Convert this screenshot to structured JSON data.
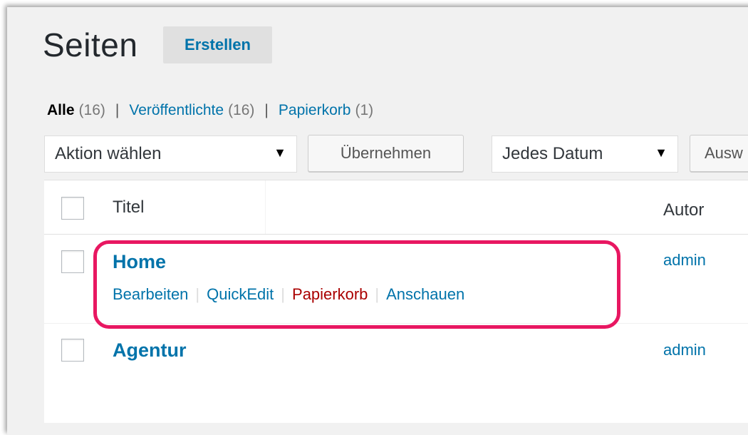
{
  "header": {
    "title": "Seiten",
    "add_new_label": "Erstellen"
  },
  "filters": {
    "all_label": "Alle",
    "all_count": "(16)",
    "published_label": "Veröffentlichte",
    "published_count": "(16)",
    "trash_label": "Papierkorb",
    "trash_count": "(1)",
    "separator": "|"
  },
  "toolbar": {
    "bulk_action_selected": "Aktion wählen",
    "apply_label": "Übernehmen",
    "date_selected": "Jedes Datum",
    "filter_button_label": "Ausw"
  },
  "table": {
    "columns": {
      "title": "Titel",
      "author": "Autor"
    },
    "rows": [
      {
        "title": "Home",
        "author": "admin",
        "actions": {
          "edit": "Bearbeiten",
          "quick_edit": "QuickEdit",
          "trash": "Papierkorb",
          "view": "Anschauen",
          "separator": "|"
        }
      },
      {
        "title": "Agentur",
        "author": "admin"
      }
    ]
  },
  "colors": {
    "link": "#0073aa",
    "trash": "#aa0000",
    "highlight": "#e81761",
    "background": "#f1f1f1"
  },
  "icons": {
    "dropdown": "triangle-down"
  }
}
